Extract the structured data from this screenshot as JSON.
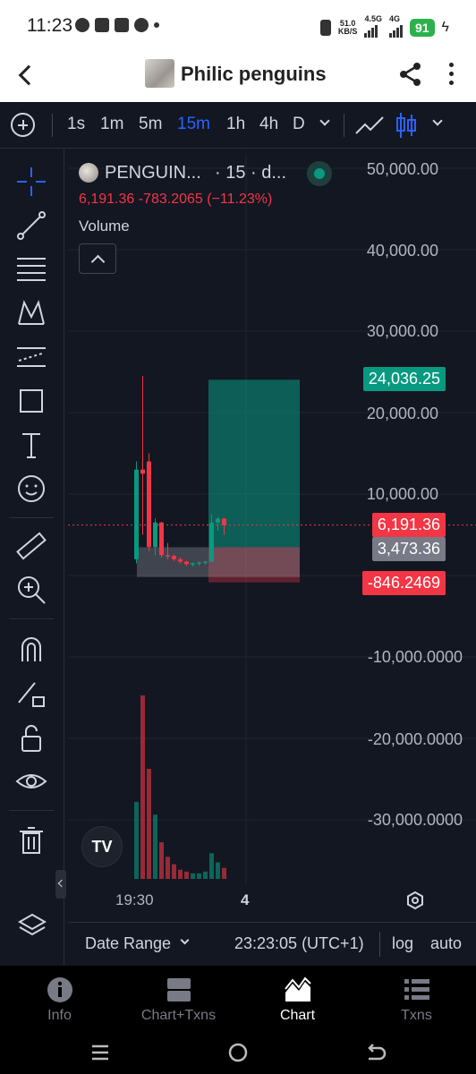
{
  "status_bar": {
    "time": "11:23",
    "net_speed_top": "51.0",
    "net_speed_bottom": "KB/S",
    "net1": "4.5G",
    "net2": "4G",
    "battery": "91"
  },
  "app_bar": {
    "title": "Philic penguins"
  },
  "toolbar": {
    "intervals": [
      "1s",
      "1m",
      "5m",
      "15m",
      "1h",
      "4h",
      "D"
    ],
    "active_interval": "15m"
  },
  "chart": {
    "symbol": "PENGUIN...",
    "interval_suffix": "· 15 · d...",
    "ohlc_text": "6,191.36  -783.2065 (−11.23%)",
    "volume_label": "Volume",
    "y_axis_labels": [
      "50,000.00",
      "40,000.00",
      "30,000.00",
      "20,000.00",
      "10,000.00",
      "-10,000.0000",
      "-20,000.0000",
      "-30,000.0000"
    ],
    "partial_label": "0.0000",
    "tags": {
      "target": "24,036.25",
      "current": "6,191.36",
      "entry": "3,473.36",
      "stop": "-846.2469"
    },
    "colors": {
      "up": "#089981",
      "down": "#f23645",
      "accent": "#2962ff",
      "entry_tag": "#787b86",
      "target_tag": "#089981"
    },
    "x_labels": [
      "19:30",
      "4"
    ],
    "logo_text": "TV"
  },
  "chart_data": {
    "type": "candlestick",
    "symbol": "PENGUIN...",
    "interval": "15",
    "ylim": [
      -35000,
      50000
    ],
    "candles": [
      {
        "open": 2000,
        "high": 14000,
        "low": 1500,
        "close": 13000
      },
      {
        "open": 13000,
        "high": 24500,
        "low": 5000,
        "close": 12500
      },
      {
        "open": 14000,
        "high": 15000,
        "low": 3000,
        "close": 3500
      },
      {
        "open": 3500,
        "high": 7000,
        "low": 2500,
        "close": 6500
      },
      {
        "open": 6500,
        "high": 6600,
        "low": 2200,
        "close": 2500
      },
      {
        "open": 2500,
        "high": 4000,
        "low": 2000,
        "close": 2400
      },
      {
        "open": 2400,
        "high": 2600,
        "low": 1800,
        "close": 2000
      },
      {
        "open": 2000,
        "high": 2200,
        "low": 1500,
        "close": 1700
      },
      {
        "open": 1700,
        "high": 1800,
        "low": 1200,
        "close": 1400
      },
      {
        "open": 1400,
        "high": 1600,
        "low": 1100,
        "close": 1500
      },
      {
        "open": 1500,
        "high": 1700,
        "low": 1200,
        "close": 1600
      },
      {
        "open": 1600,
        "high": 1800,
        "low": 1300,
        "close": 1700
      },
      {
        "open": 1700,
        "high": 7500,
        "low": 1600,
        "close": 6500
      },
      {
        "open": 6500,
        "high": 7200,
        "low": 5500,
        "close": 6974
      },
      {
        "open": 6974,
        "high": 7100,
        "low": 5000,
        "close": 6191.36
      }
    ],
    "volumes": [
      42,
      100,
      60,
      35,
      20,
      12,
      8,
      5,
      4,
      3,
      3,
      4,
      14,
      9,
      6
    ],
    "position": {
      "target": 24036.25,
      "entry": 3473.36,
      "stop": -846.2469
    }
  },
  "bottom_bar": {
    "date_range": "Date Range",
    "time": "23:23:05 (UTC+1)",
    "log": "log",
    "auto": "auto"
  },
  "nav": {
    "items": [
      "Info",
      "Chart+Txns",
      "Chart",
      "Txns"
    ],
    "active": "Chart"
  },
  "icons": [
    "messenger-icon",
    "person-add-icon",
    "whatsapp-icon",
    "vibrate-icon",
    "wifi-icon",
    "signal-icon",
    "share-icon",
    "more-icon",
    "crosshair-icon",
    "trendline-icon",
    "fib-icon",
    "pattern-icon",
    "prediction-icon",
    "rectangle-icon",
    "text-icon",
    "emoji-icon",
    "ruler-icon",
    "zoom-icon",
    "magnet-icon",
    "lock-pencil-icon",
    "lock-icon",
    "eye-icon",
    "trash-icon",
    "layers-icon",
    "gear-icon"
  ]
}
